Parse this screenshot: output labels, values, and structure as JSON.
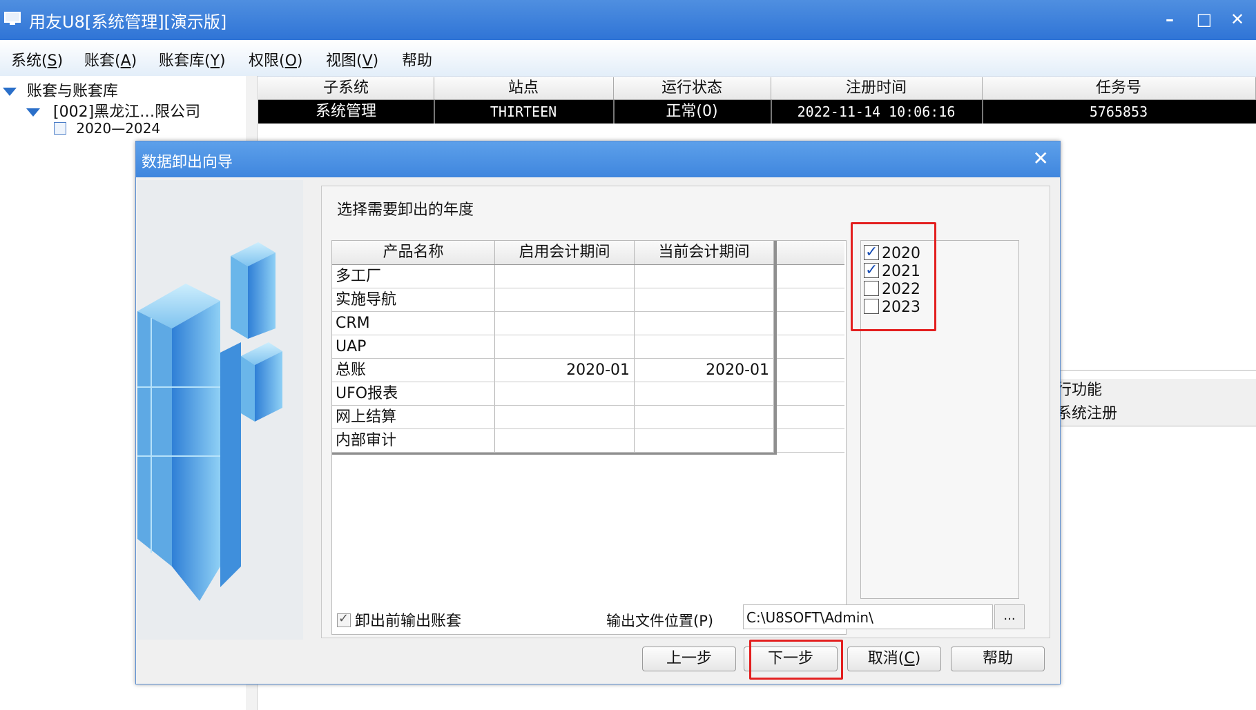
{
  "window": {
    "title": "用友U8[系统管理][演示版]",
    "minimize_glyph": "–",
    "maximize_glyph": "□",
    "close_glyph": "✕"
  },
  "menu": {
    "items": [
      {
        "label_main": "系统(",
        "key": "S",
        "end": ")"
      },
      {
        "label_main": "账套(",
        "key": "A",
        "end": ")"
      },
      {
        "label_main": "账套库(",
        "key": "Y",
        "end": ")"
      },
      {
        "label_main": "权限(",
        "key": "O",
        "end": ")"
      },
      {
        "label_main": "视图(",
        "key": "V",
        "end": ")"
      },
      {
        "label_main": "帮助",
        "key": "",
        "end": ""
      }
    ]
  },
  "tree": {
    "root": "账套与账套库",
    "company": "[002]黑龙江…限公司",
    "year_range": "2020—2024"
  },
  "grid": {
    "headers": [
      "子系统",
      "站点",
      "运行状态",
      "注册时间",
      "任务号"
    ],
    "row": [
      "系统管理",
      "THIRTEEN",
      "正常(0)",
      "2022-11-14 10:06:16",
      "5765853"
    ]
  },
  "background_panel": {
    "line1": "行功能",
    "line2": "系统注册"
  },
  "dialog": {
    "title": "数据卸出向导",
    "close_glyph": "✕",
    "section_label": "选择需要卸出的年度",
    "table": {
      "headers": [
        "产品名称",
        "启用会计期间",
        "当前会计期间"
      ],
      "rows": [
        {
          "name": "多工厂",
          "start": "",
          "current": ""
        },
        {
          "name": "实施导航",
          "start": "",
          "current": ""
        },
        {
          "name": "CRM",
          "start": "",
          "current": ""
        },
        {
          "name": "UAP",
          "start": "",
          "current": ""
        },
        {
          "name": "总账",
          "start": "2020-01",
          "current": "2020-01"
        },
        {
          "name": "UFO报表",
          "start": "",
          "current": ""
        },
        {
          "name": "网上结算",
          "start": "",
          "current": ""
        },
        {
          "name": "内部审计",
          "start": "",
          "current": ""
        }
      ]
    },
    "years": [
      {
        "year": "2020",
        "checked": true
      },
      {
        "year": "2021",
        "checked": true
      },
      {
        "year": "2022",
        "checked": false
      },
      {
        "year": "2023",
        "checked": false
      }
    ],
    "export_before_label": "卸出前输出账套",
    "export_before_checked": true,
    "output_path_label": "输出文件位置(P)",
    "output_path_value": "C:\\U8SOFT\\Admin\\",
    "browse_label": "...",
    "buttons": {
      "prev": "上一步",
      "next": "下一步",
      "cancel_main": "取消(",
      "cancel_key": "C",
      "cancel_end": ")",
      "help": "帮助"
    },
    "highlight_color": "#e31f1f"
  }
}
